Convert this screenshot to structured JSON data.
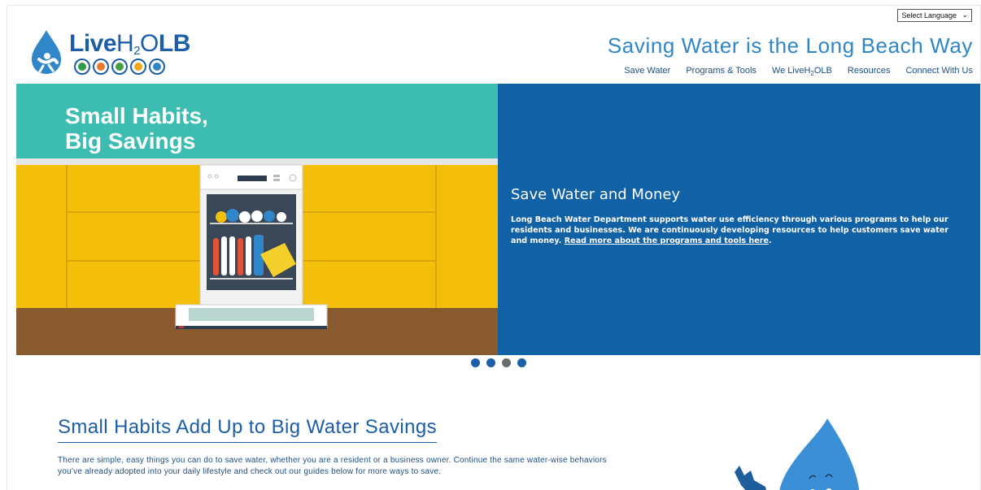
{
  "language_select": {
    "value": "Select Language"
  },
  "logo": {
    "live": "Live",
    "h": "H",
    "sub": "2",
    "o": "O",
    "lb": "LB",
    "badge_colors": [
      "#2f9a48",
      "#e9782b",
      "#43a047",
      "#f2a71b",
      "#2f86c8"
    ]
  },
  "header": {
    "tagline": "Saving Water is the Long Beach Way"
  },
  "nav": {
    "items": [
      {
        "label": "Save Water"
      },
      {
        "label": "Programs & Tools"
      },
      {
        "label_prefix": "We LiveH",
        "label_sub": "2",
        "label_suffix": "OLB"
      },
      {
        "label": "Resources"
      },
      {
        "label": "Connect With Us"
      }
    ]
  },
  "hero": {
    "slide_heading": "Small Habits,\nBig Savings",
    "title": "Save Water and Money",
    "body": "Long Beach Water Department supports water use efficiency through various programs to help our residents and businesses. We are continuously developing resources to help customers save water and money. ",
    "link": "Read more about the programs and tools here",
    "body_end": ".",
    "carousel": {
      "count": 4,
      "active_index": 2
    }
  },
  "section": {
    "title": "Small Habits Add Up to Big Water Savings",
    "text": "There are simple, easy things you can do to save water, whether you are a resident or a business owner. Continue the same water-wise behaviors you’ve already adopted into your daily lifestyle and check out our guides below for more ways to save."
  },
  "colors": {
    "teal": "#3dbcb1",
    "blue_panel": "#1161a7",
    "yellow": "#f4bf0a",
    "floor": "#8a5a2f"
  }
}
